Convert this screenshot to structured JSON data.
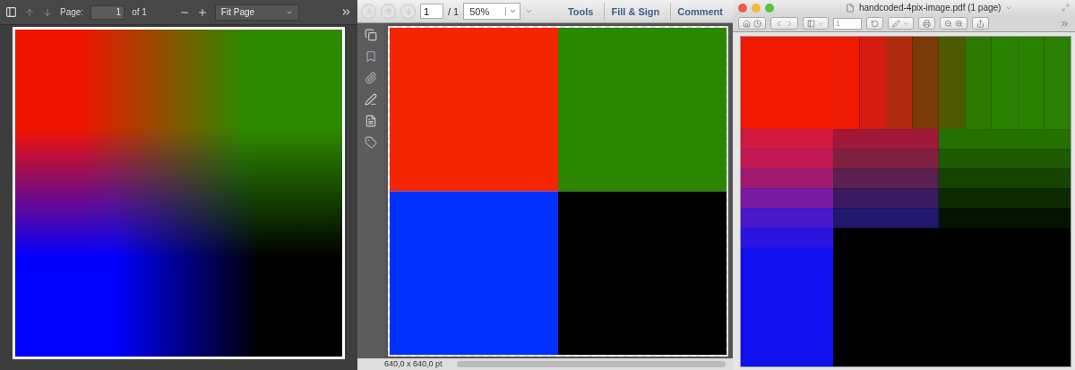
{
  "left_viewer": {
    "toolbar": {
      "page_label": "Page:",
      "page_value": "1",
      "page_count": "of 1",
      "zoom": "Fit Page"
    }
  },
  "middle_viewer": {
    "toolbar": {
      "page_value": "1",
      "page_count": "/ 1",
      "zoom": "50%",
      "tabs": [
        {
          "label": "Tools"
        },
        {
          "label": "Fill & Sign"
        },
        {
          "label": "Comment"
        }
      ]
    },
    "status_bar": {
      "size": "640,0 x 640,0 pt"
    }
  },
  "right_viewer": {
    "window": {
      "title": "handcoded-4pix-image.pdf (1 page)"
    },
    "toolbar": {
      "page_value": "1"
    }
  }
}
